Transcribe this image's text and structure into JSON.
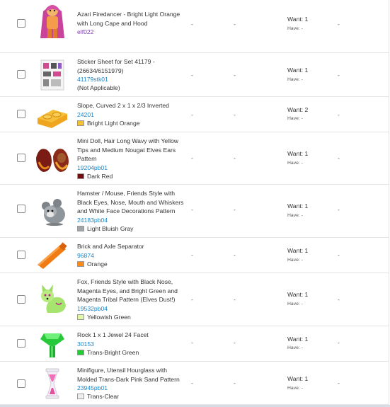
{
  "dash": "-",
  "rows": [
    {
      "name": "Azari Firedancer - Bright Light Orange with Long Cape and Hood",
      "id": "elf022",
      "id_color": "purple",
      "want": "Want: 1",
      "have": "Have: -",
      "icon": "minifig-icon"
    },
    {
      "name": "Sticker Sheet for Set 41179 - (26634/6151979)",
      "id": "41179stk01",
      "note": "(Not Applicable)",
      "want": "Want: 1",
      "have": "Have: -",
      "icon": "sticker-sheet-icon"
    },
    {
      "name": "Slope, Curved 2 x 1 x 2/3 Inverted",
      "id": "24201",
      "color_name": "Bright Light Orange",
      "swatch": "#f4c12a",
      "want": "Want: 2",
      "have": "Have: -",
      "icon": "curved-slope-icon"
    },
    {
      "name": "Mini Doll, Hair Long Wavy with Yellow Tips and Medium Nougat Elves Ears Pattern",
      "id": "19204pb01",
      "color_name": "Dark Red",
      "swatch": "#720e0f",
      "want": "Want: 1",
      "have": "Have: -",
      "icon": "doll-hair-icon"
    },
    {
      "name": "Hamster / Mouse, Friends Style with Black Eyes, Nose, Mouth and Whiskers and White Face Decorations Pattern",
      "id": "24183pb04",
      "color_name": "Light Bluish Gray",
      "swatch": "#a0a5a9",
      "want": "Want: 1",
      "have": "Have: -",
      "icon": "hamster-icon"
    },
    {
      "name": "Brick and Axle Separator",
      "id": "96874",
      "color_name": "Orange",
      "swatch": "#fe8a18",
      "want": "Want: 1",
      "have": "Have: -",
      "icon": "separator-tool-icon"
    },
    {
      "name": "Fox, Friends Style with Black Nose, Magenta Eyes, and Bright Green and Magenta Tribal Pattern (Elves Dust!)",
      "id": "19532pb04",
      "color_name": "Yellowish Green",
      "swatch": "#dff6a5",
      "want": "Want: 1",
      "have": "Have: -",
      "icon": "fox-icon"
    },
    {
      "name": "Rock 1 x 1 Jewel 24 Facet",
      "id": "30153",
      "color_name": "Trans-Bright Green",
      "swatch": "#22cc33",
      "want": "Want: 1",
      "have": "Have: -",
      "icon": "jewel-icon"
    },
    {
      "name": "Minifigure, Utensil Hourglass with Molded Trans-Dark Pink Sand Pattern",
      "id": "23945pb01",
      "color_name": "Trans-Clear",
      "swatch": "#eeeeee",
      "want": "Want: 1",
      "have": "Have: -",
      "icon": "hourglass-icon"
    }
  ]
}
